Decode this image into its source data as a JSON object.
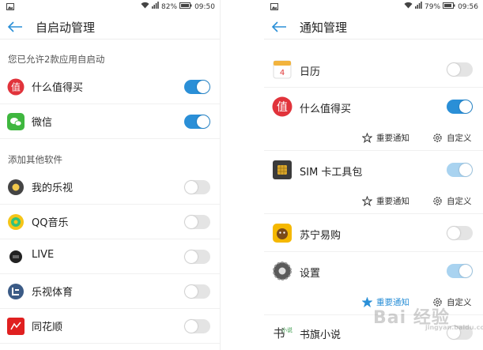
{
  "left": {
    "status": {
      "battery": "82%",
      "time": "09:50"
    },
    "title": "自启动管理",
    "allowed_section": "您已允许2款应用自启动",
    "allowed_apps": [
      {
        "name": "什么值得买",
        "on": true
      },
      {
        "name": "微信",
        "on": true
      }
    ],
    "other_section": "添加其他软件",
    "other_apps": [
      {
        "name": "我的乐视",
        "on": false
      },
      {
        "name": "QQ音乐",
        "on": false
      },
      {
        "name": "LIVE",
        "on": false
      },
      {
        "name": "乐视体育",
        "on": false
      },
      {
        "name": "同花顺",
        "on": false
      }
    ]
  },
  "right": {
    "status": {
      "battery": "79%",
      "time": "09:56"
    },
    "title": "通知管理",
    "apps": [
      {
        "name": "日历",
        "on": false
      },
      {
        "name": "什么值得买",
        "on": true,
        "important": "重要通知",
        "custom": "自定义"
      },
      {
        "name": "SIM 卡工具包",
        "on": true,
        "important": "重要通知",
        "custom": "自定义"
      },
      {
        "name": "苏宁易购",
        "on": false
      },
      {
        "name": "设置",
        "on": true,
        "important": "重要通知",
        "custom": "自定义"
      },
      {
        "name": "书旗小说",
        "on": false
      }
    ]
  },
  "watermark": {
    "text": "Bai 经验",
    "sub": "jingyan.baidu.com"
  },
  "colors": {
    "accent": "#2a8fd7",
    "switch_off": "#e4e4e4",
    "section_text": "#555555"
  }
}
